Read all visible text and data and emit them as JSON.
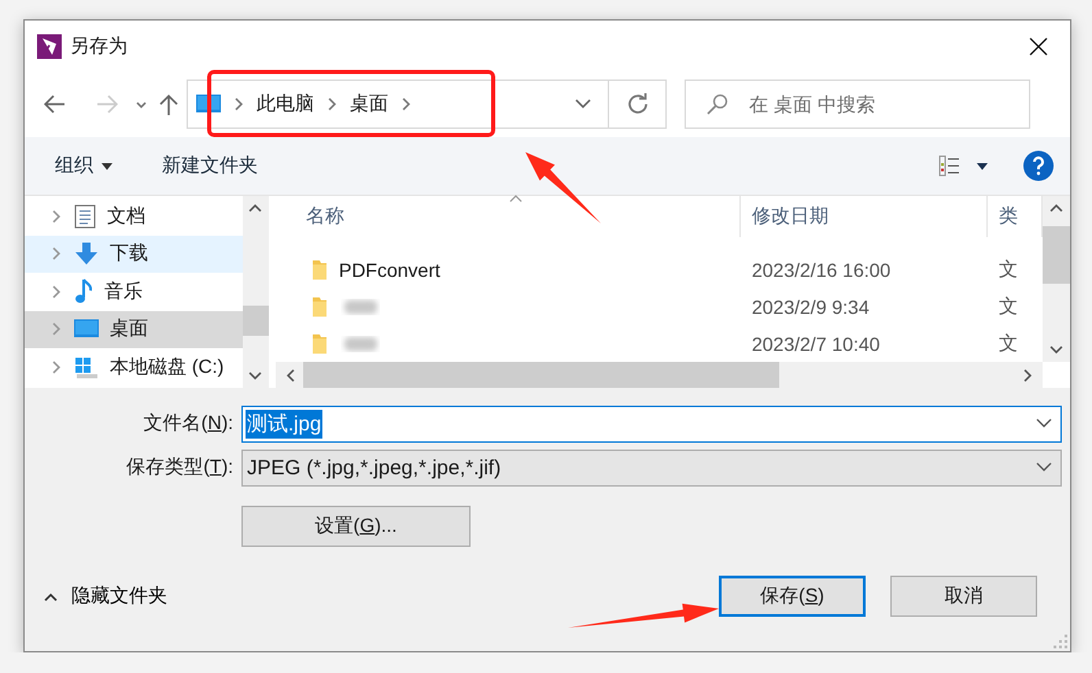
{
  "window": {
    "title": "另存为"
  },
  "address": {
    "crumbs": [
      "此电脑",
      "桌面"
    ]
  },
  "search": {
    "placeholder": "在 桌面 中搜索"
  },
  "toolbar": {
    "buttons": [
      {
        "label": "组织",
        "dropdown": true
      },
      {
        "label": "新建文件夹",
        "dropdown": false
      }
    ]
  },
  "sidebar": {
    "items": [
      {
        "label": "文档",
        "kind": "documents",
        "selected": false,
        "hovered": false
      },
      {
        "label": "下载",
        "kind": "downloads",
        "selected": false,
        "hovered": true
      },
      {
        "label": "音乐",
        "kind": "music",
        "selected": false,
        "hovered": false
      },
      {
        "label": "桌面",
        "kind": "desktop",
        "selected": true,
        "hovered": false
      },
      {
        "label": "本地磁盘 (C:)",
        "kind": "drive",
        "selected": false,
        "hovered": false
      }
    ]
  },
  "file_list": {
    "columns": [
      "名称",
      "修改日期",
      "类"
    ],
    "rows": [
      {
        "kind": "plain",
        "name": "PDFconvert",
        "modified": "2023/2/16 16:00",
        "column_3": "文"
      },
      {
        "kind": "redacted",
        "modified": "2023/2/9 9:34",
        "column_3": "文"
      },
      {
        "kind": "redacted",
        "modified": "2023/2/7 10:40",
        "column_3": "文"
      }
    ]
  },
  "filename": {
    "label_parts": [
      "文件名(",
      "N",
      "):"
    ],
    "value": "测试.jpg",
    "selected": true
  },
  "file_type": {
    "label_parts": [
      "保存类型(",
      "T",
      "):"
    ],
    "value": "JPEG (*.jpg,*.jpeg,*.jpe,*.jif)"
  },
  "settings_button": {
    "label_parts": [
      "设置(",
      "G",
      ")..."
    ]
  },
  "hide_folders": {
    "label": "隐藏文件夹"
  },
  "buttons": [
    {
      "label_parts": [
        "保存(",
        "S",
        ")"
      ],
      "default": true
    },
    {
      "label_parts": [
        "取消"
      ],
      "default": false
    }
  ]
}
